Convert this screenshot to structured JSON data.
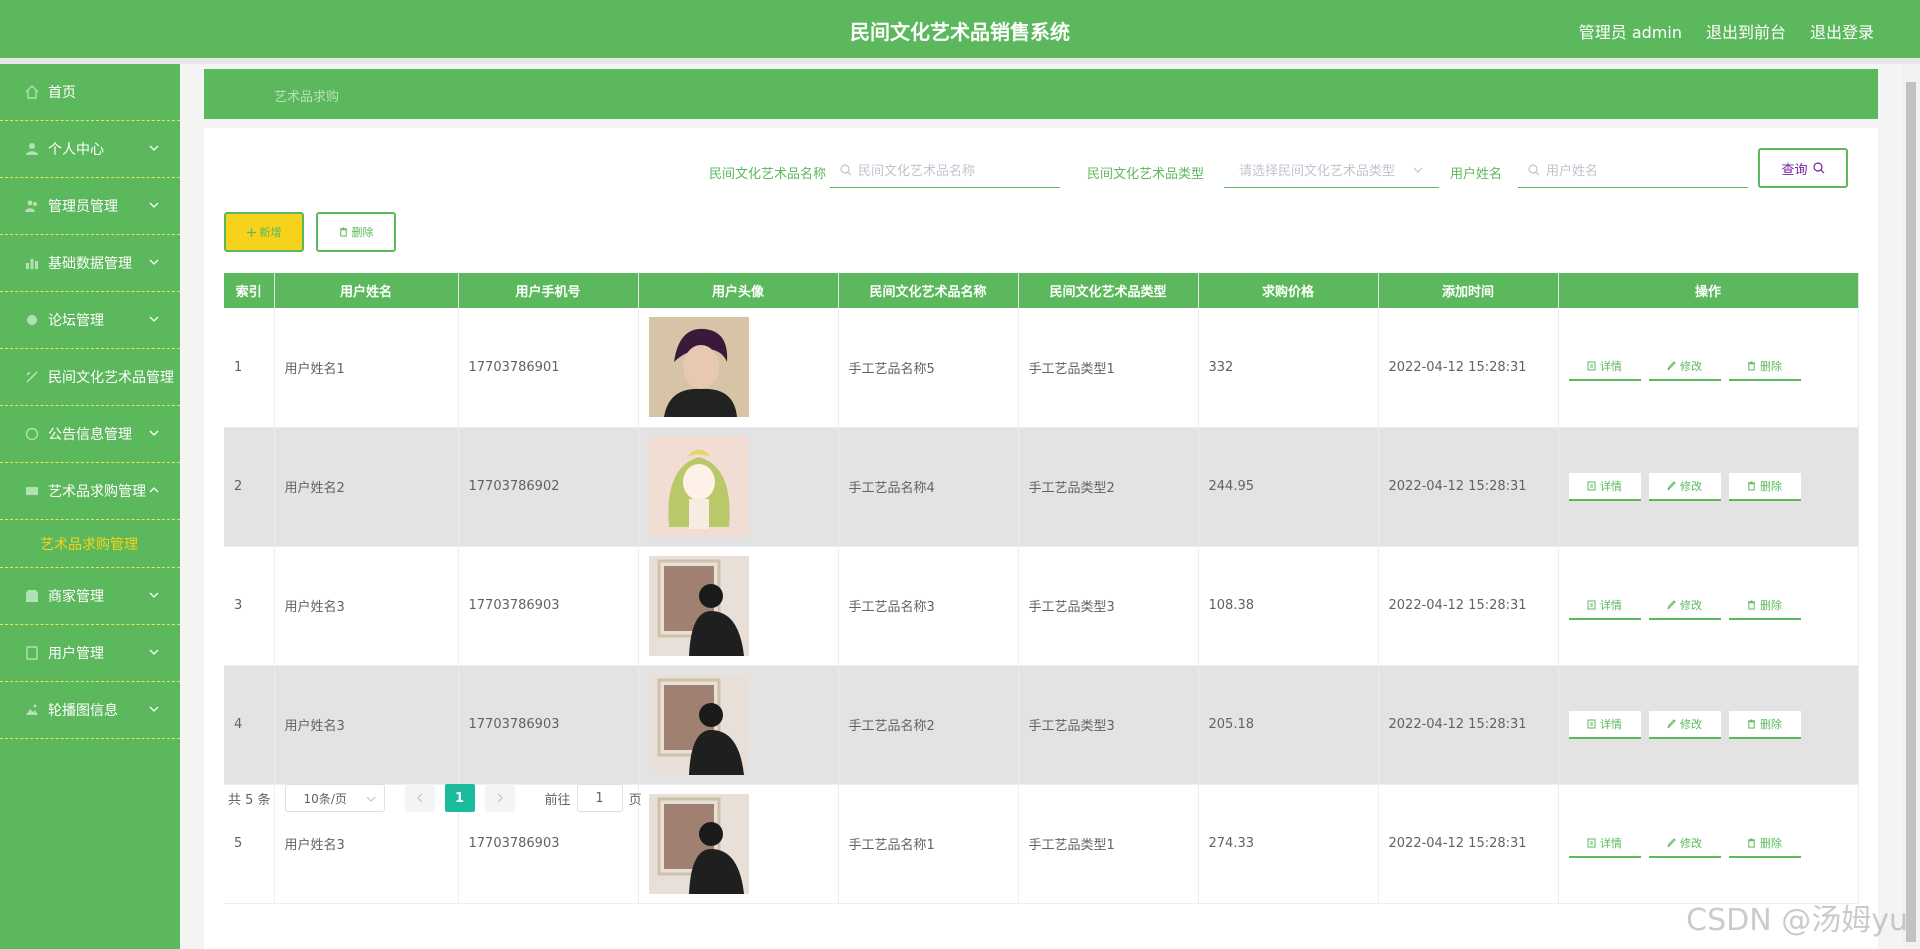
{
  "header": {
    "title": "民间文化艺术品销售系统",
    "admin": "管理员 admin",
    "to_front": "退出到前台",
    "logout": "退出登录"
  },
  "sidebar": {
    "items": [
      {
        "label": "首页",
        "icon": "home-icon"
      },
      {
        "label": "个人中心",
        "icon": "user-icon"
      },
      {
        "label": "管理员管理",
        "icon": "users-icon"
      },
      {
        "label": "基础数据管理",
        "icon": "chart-icon"
      },
      {
        "label": "论坛管理",
        "icon": "forum-icon"
      },
      {
        "label": "民间文化艺术品管理",
        "icon": "art-icon"
      },
      {
        "label": "公告信息管理",
        "icon": "notice-icon"
      },
      {
        "label": "艺术品求购管理",
        "icon": "cart-icon"
      },
      {
        "label": "艺术品求购管理",
        "icon": ""
      },
      {
        "label": "商家管理",
        "icon": "shop-icon"
      },
      {
        "label": "用户管理",
        "icon": "person-icon"
      },
      {
        "label": "轮播图信息",
        "icon": "image-icon"
      }
    ]
  },
  "breadcrumb": "艺术品求购",
  "search": {
    "name_label": "民间文化艺术品名称",
    "name_placeholder": "民间文化艺术品名称",
    "type_label": "民间文化艺术品类型",
    "type_placeholder": "请选择民间文化艺术品类型",
    "user_label": "用户姓名",
    "user_placeholder": "用户姓名",
    "query_label": "查询"
  },
  "toolbar": {
    "add_label": "新增",
    "delete_label": "删除"
  },
  "table": {
    "headers": [
      "索引",
      "用户姓名",
      "用户手机号",
      "用户头像",
      "民间文化艺术品名称",
      "民间文化艺术品类型",
      "求购价格",
      "添加时间",
      "操作"
    ],
    "rows": [
      {
        "index": "1",
        "name": "用户姓名1",
        "phone": "17703786901",
        "avatar": "boy",
        "item": "手工艺品名称5",
        "type": "手工艺品类型1",
        "price": "332",
        "time": "2022-04-12 15:28:31"
      },
      {
        "index": "2",
        "name": "用户姓名2",
        "phone": "17703786902",
        "avatar": "doll",
        "item": "手工艺品名称4",
        "type": "手工艺品类型2",
        "price": "244.95",
        "time": "2022-04-12 15:28:31"
      },
      {
        "index": "3",
        "name": "用户姓名3",
        "phone": "17703786903",
        "avatar": "back",
        "item": "手工艺品名称3",
        "type": "手工艺品类型3",
        "price": "108.38",
        "time": "2022-04-12 15:28:31"
      },
      {
        "index": "4",
        "name": "用户姓名3",
        "phone": "17703786903",
        "avatar": "back",
        "item": "手工艺品名称2",
        "type": "手工艺品类型3",
        "price": "205.18",
        "time": "2022-04-12 15:28:31"
      },
      {
        "index": "5",
        "name": "用户姓名3",
        "phone": "17703786903",
        "avatar": "back",
        "item": "手工艺品名称1",
        "type": "手工艺品类型1",
        "price": "274.33",
        "time": "2022-04-12 15:28:31"
      }
    ],
    "op_detail": "详情",
    "op_edit": "修改",
    "op_delete": "删除"
  },
  "pagination": {
    "total": "共 5 条",
    "page_size": "10条/页",
    "current": "1",
    "goto_prefix": "前往",
    "goto_value": "1",
    "goto_suffix": "页"
  },
  "watermark": "CSDN @汤姆yu",
  "colors": {
    "primary": "#5cb85c",
    "accent_yellow": "#f6d21d",
    "page_active": "#1abc9c"
  }
}
